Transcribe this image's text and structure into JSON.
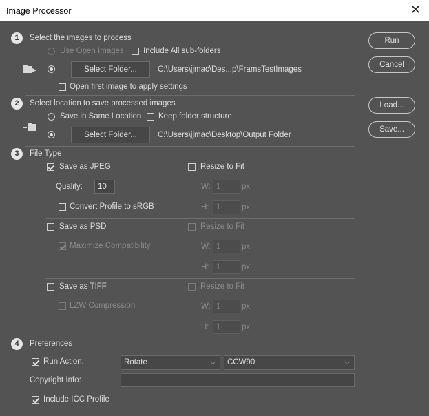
{
  "window": {
    "title": "Image Processor",
    "close": "✕"
  },
  "section1": {
    "number": "1",
    "title": "Select the images to process",
    "use_open_images": "Use Open Images",
    "include_subfolders": "Include All sub-folders",
    "select_folder": "Select Folder...",
    "folder_path": "C:\\Users\\jjmac\\Des...p\\FramsTestImages",
    "open_first_image": "Open first image to apply settings"
  },
  "section2": {
    "number": "2",
    "title": "Select location to save processed images",
    "save_same_location": "Save in Same Location",
    "keep_structure": "Keep folder structure",
    "select_folder": "Select Folder...",
    "folder_path": "C:\\Users\\jjmac\\Desktop\\Output Folder"
  },
  "section3": {
    "number": "3",
    "title": "File Type",
    "jpeg": {
      "save_as": "Save as JPEG",
      "checked": true,
      "resize": "Resize to Fit",
      "quality_label": "Quality:",
      "quality_value": "10",
      "convert_profile": "Convert Profile to sRGB",
      "w_label": "W:",
      "w_value": "1",
      "w_unit": "px",
      "h_label": "H:",
      "h_value": "1",
      "h_unit": "px"
    },
    "psd": {
      "save_as": "Save as PSD",
      "checked": false,
      "resize": "Resize to Fit",
      "maximize": "Maximize Compatibility",
      "w_label": "W:",
      "w_value": "1",
      "w_unit": "px",
      "h_label": "H:",
      "h_value": "1",
      "h_unit": "px"
    },
    "tiff": {
      "save_as": "Save as TIFF",
      "checked": false,
      "resize": "Resize to Fit",
      "lzw": "LZW Compression",
      "w_label": "W:",
      "w_value": "1",
      "w_unit": "px",
      "h_label": "H:",
      "h_value": "1",
      "h_unit": "px"
    }
  },
  "section4": {
    "number": "4",
    "title": "Preferences",
    "run_action": "Run Action:",
    "action_set": "Rotate",
    "action": "CCW90",
    "copyright": "Copyright Info:",
    "copyright_value": "",
    "include_icc": "Include ICC Profile"
  },
  "buttons": {
    "run": "Run",
    "cancel": "Cancel",
    "load": "Load...",
    "save": "Save..."
  },
  "colors": {
    "background": "#535353",
    "text": "#e0e0e0",
    "disabled_text": "#8a8a8a"
  }
}
